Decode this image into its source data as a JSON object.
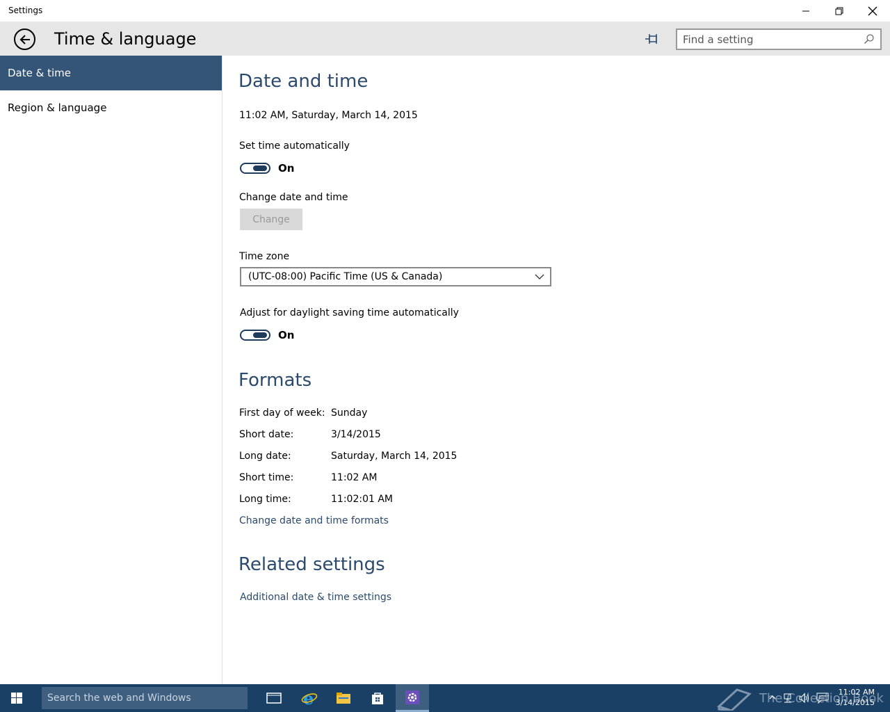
{
  "window": {
    "title": "Settings",
    "minimize_icon": "minimize-icon",
    "restore_icon": "restore-icon",
    "close_icon": "close-icon"
  },
  "header": {
    "back_icon": "back-arrow-icon",
    "title": "Time & language",
    "pin_icon": "pin-icon",
    "search": {
      "placeholder": "Find a setting",
      "value": "",
      "icon": "search-icon"
    }
  },
  "sidebar": {
    "items": [
      {
        "label": "Date & time",
        "active": true
      },
      {
        "label": "Region & language",
        "active": false
      }
    ]
  },
  "date_time": {
    "title": "Date and time",
    "current": "11:02 AM, Saturday, March 14, 2015",
    "set_time_auto": {
      "label": "Set time automatically",
      "state": "On",
      "on": true
    },
    "change": {
      "label": "Change date and time",
      "button": "Change",
      "disabled": true
    },
    "time_zone": {
      "label": "Time zone",
      "selected": "(UTC-08:00) Pacific Time (US & Canada)"
    },
    "dst_auto": {
      "label": "Adjust for daylight saving time automatically",
      "state": "On",
      "on": true
    }
  },
  "formats": {
    "title": "Formats",
    "rows": [
      {
        "label": "First day of week:",
        "value": "Sunday"
      },
      {
        "label": "Short date:",
        "value": "3/14/2015"
      },
      {
        "label": "Long date:",
        "value": "Saturday, March 14, 2015"
      },
      {
        "label": "Short time:",
        "value": "11:02 AM"
      },
      {
        "label": "Long time:",
        "value": "11:02:01 AM"
      }
    ],
    "link": "Change date and time formats"
  },
  "related": {
    "title": "Related settings",
    "link": "Additional date & time settings"
  },
  "taskbar": {
    "search_placeholder": "Search the web and Windows",
    "apps": [
      "task-view-icon",
      "internet-explorer-icon",
      "file-explorer-icon",
      "store-icon",
      "settings-icon"
    ],
    "watermark": "The Collection Book",
    "clock_time": "11:02 AM",
    "clock_date": "3/14/2015",
    "accent": "#1b4066"
  },
  "colors": {
    "sidebar_active": "#345478",
    "accent_text": "#2a4a6e",
    "header_bg": "#e6e6e6"
  }
}
